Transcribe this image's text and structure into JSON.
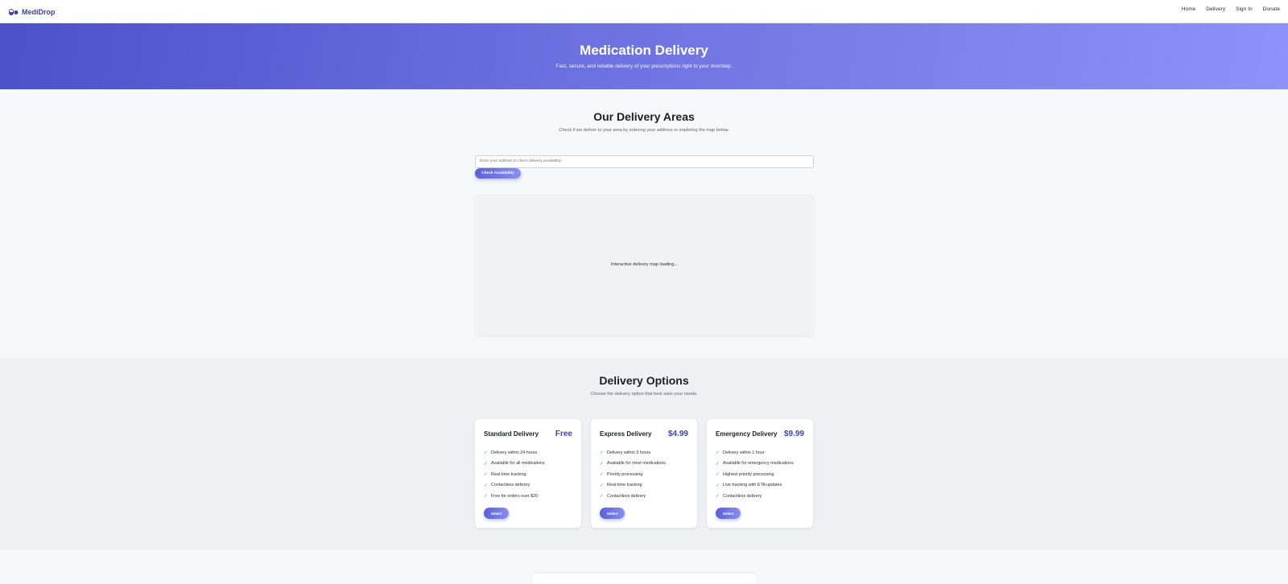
{
  "header": {
    "brand": "MediDrop",
    "nav": [
      "Home",
      "Delivery",
      "Sign In",
      "Donate"
    ]
  },
  "hero": {
    "title": "Medication Delivery",
    "subtitle": "Fast, secure, and reliable delivery of your prescriptions right to your doorstep."
  },
  "areas": {
    "title": "Our Delivery Areas",
    "subtitle": "Check if we deliver to your area by entering your address or exploring the map below.",
    "address_placeholder": "Enter your address to check delivery availability",
    "check_button": "Check Availability",
    "map_text": "Interactive delivery map loading..."
  },
  "options": {
    "title": "Delivery Options",
    "subtitle": "Choose the delivery option that best suits your needs.",
    "cards": [
      {
        "title": "Standard Delivery",
        "price": "Free",
        "features": [
          "Delivery within 24 hours",
          "Available for all medications",
          "Real-time tracking",
          "Contactless delivery",
          "Free for orders over $20"
        ],
        "button": "Select"
      },
      {
        "title": "Express Delivery",
        "price": "$4.99",
        "features": [
          "Delivery within 3 hours",
          "Available for most medications",
          "Priority processing",
          "Real-time tracking",
          "Contactless delivery"
        ],
        "button": "Select"
      },
      {
        "title": "Emergency Delivery",
        "price": "$9.99",
        "features": [
          "Delivery within 1 hour",
          "Available for emergency medications",
          "Highest priority processing",
          "Live tracking with ETA updates",
          "Contactless delivery"
        ],
        "button": "Select"
      }
    ]
  },
  "icons": {
    "logo": "pills-icon",
    "feature": "check-icon"
  },
  "colors": {
    "brand": "#3b3fb0",
    "accent": "#5a5fd6",
    "price": "#3e43b8",
    "check": "#2eb872"
  }
}
